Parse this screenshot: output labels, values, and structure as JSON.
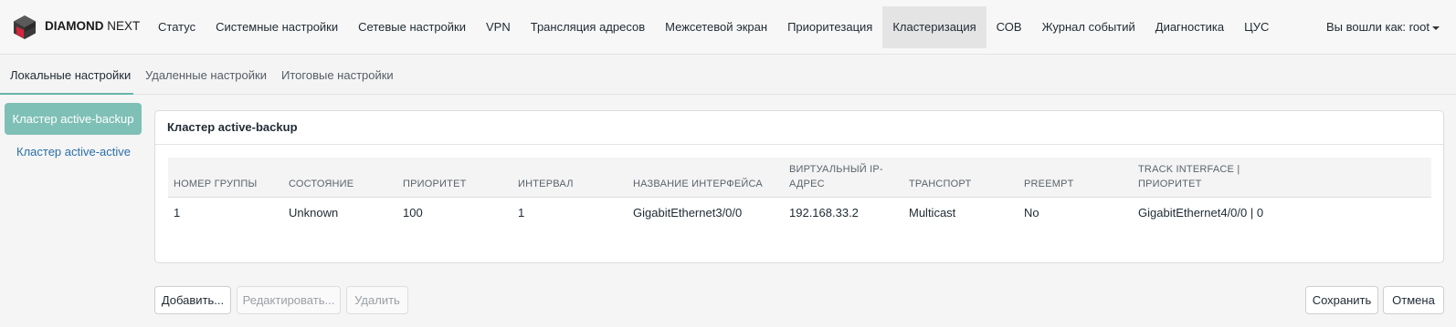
{
  "header": {
    "brand_bold": "DIAMOND",
    "brand_light": "NEXT",
    "user_label": "Вы вошли как: root"
  },
  "nav": {
    "items": [
      {
        "label": "Статус"
      },
      {
        "label": "Системные настройки"
      },
      {
        "label": "Сетевые настройки"
      },
      {
        "label": "VPN"
      },
      {
        "label": "Трансляция адресов"
      },
      {
        "label": "Межсетевой экран"
      },
      {
        "label": "Приоритезация"
      },
      {
        "label": "Кластеризация"
      },
      {
        "label": "СОВ"
      },
      {
        "label": "Журнал событий"
      },
      {
        "label": "Диагностика"
      },
      {
        "label": "ЦУС"
      }
    ],
    "active": "Кластеризация"
  },
  "subtabs": {
    "items": [
      {
        "label": "Локальные настройки"
      },
      {
        "label": "Удаленные настройки"
      },
      {
        "label": "Итоговые настройки"
      }
    ],
    "active": "Локальные настройки"
  },
  "sidebar": {
    "items": [
      {
        "label": "Кластер active-backup"
      },
      {
        "label": "Кластер active-active"
      }
    ],
    "active": "Кластер active-backup"
  },
  "panel": {
    "title": "Кластер active-backup",
    "columns": [
      "Номер группы",
      "Состояние",
      "Приоритет",
      "Интервал",
      "Название интерфейса",
      "Виртуальный IP-адрес",
      "Транспорт",
      "Preempt",
      "Track interface | приоритет"
    ],
    "rows": [
      [
        "1",
        "Unknown",
        "100",
        "1",
        "GigabitEthernet3/0/0",
        "192.168.33.2",
        "Multicast",
        "No",
        "GigabitEthernet4/0/0 | 0"
      ]
    ]
  },
  "actions": {
    "add": "Добавить...",
    "edit": "Редактировать...",
    "delete": "Удалить",
    "save": "Сохранить",
    "cancel": "Отмена"
  },
  "colors": {
    "accent": "#7fc0b6",
    "link": "#2b6fa8",
    "logo_red": "#d6263c",
    "logo_dark": "#3a3a3a"
  }
}
